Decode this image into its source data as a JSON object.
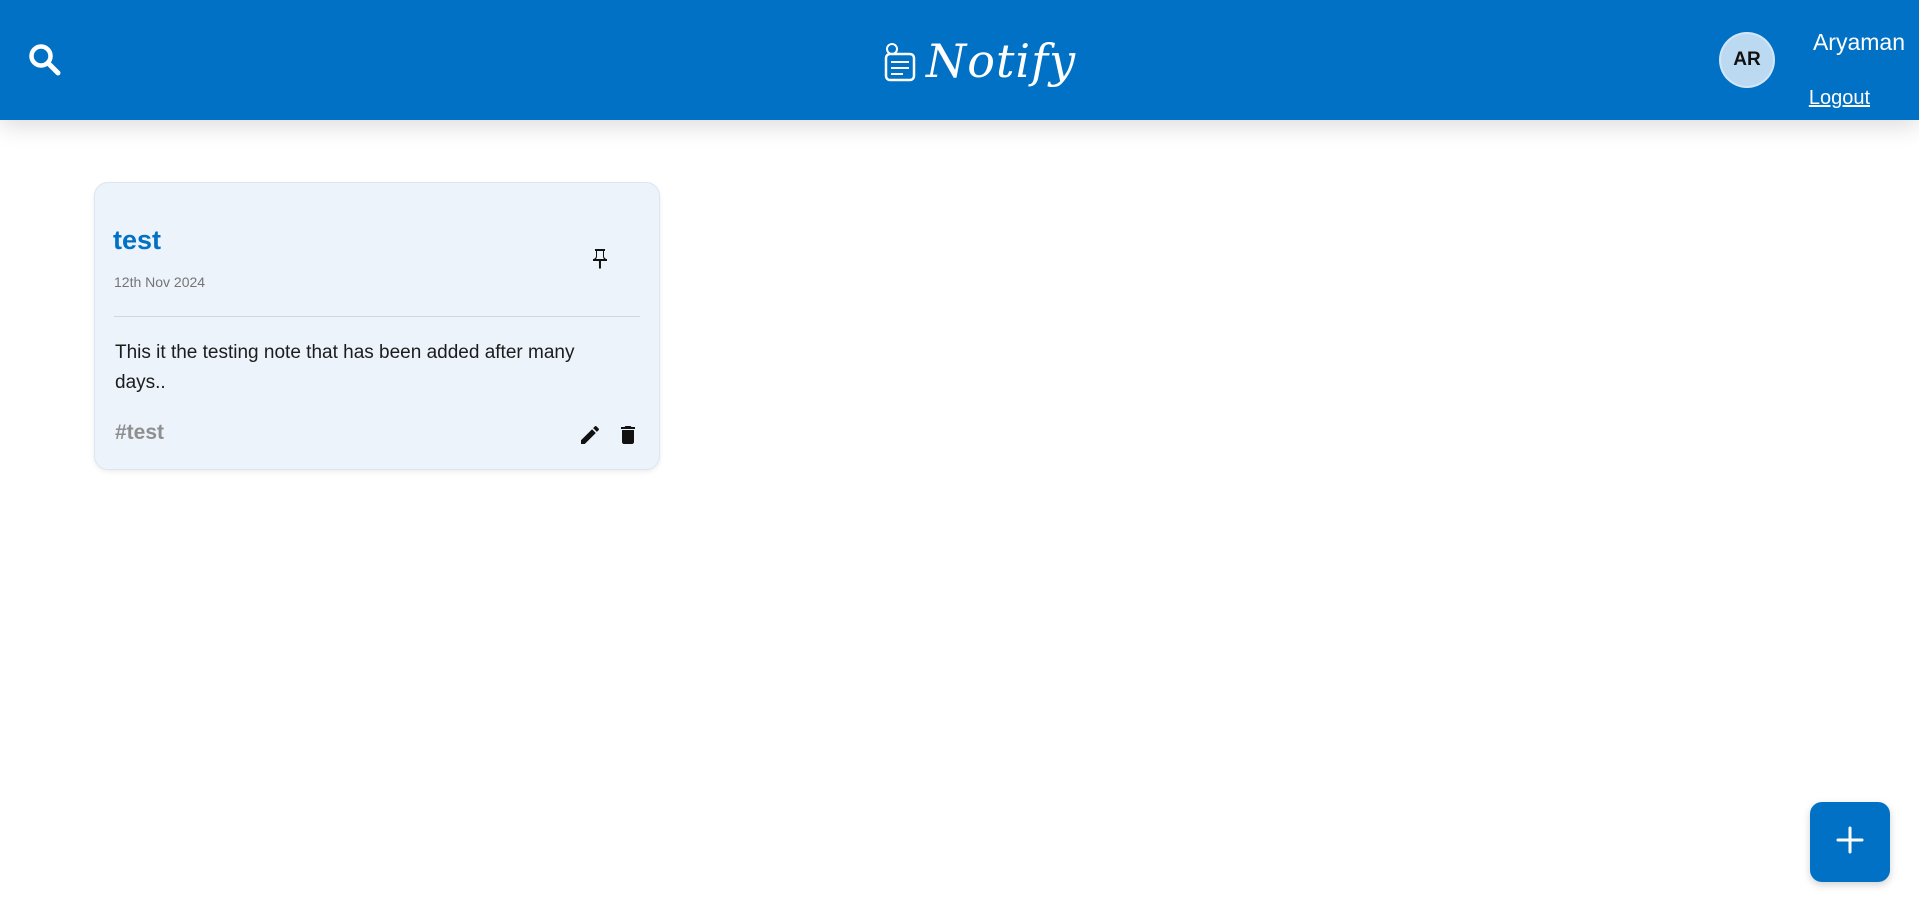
{
  "header": {
    "app_name": "Notify",
    "search_icon": "search-icon",
    "logo_icon": "notepad-icon",
    "user": {
      "initials": "AR",
      "name": "Aryaman",
      "logout_label": "Logout"
    }
  },
  "notes": [
    {
      "title": "test",
      "date": "12th Nov 2024",
      "content": "This it the testing note that has been added after many days..",
      "tag": "#test",
      "pin_icon": "pin-icon",
      "edit_icon": "pencil-icon",
      "delete_icon": "trash-icon"
    }
  ],
  "fab": {
    "icon": "plus-icon"
  },
  "colors": {
    "primary": "#0071c5",
    "card_bg": "#ecf3fa",
    "avatar_bg": "#bcd9f2",
    "tag_text": "#8f8f8f",
    "date_text": "#757575"
  }
}
